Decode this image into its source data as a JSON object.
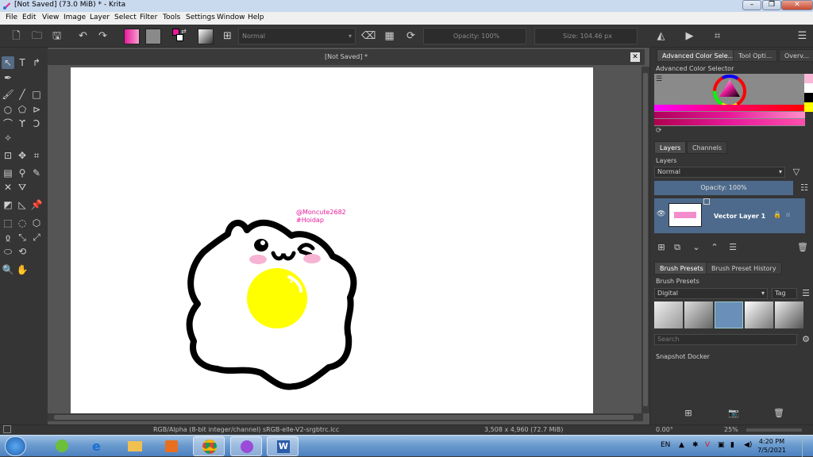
{
  "window": {
    "title": "[Not Saved]  (73.0 MiB)  * - Krita",
    "controls": {
      "minimize": "–",
      "maximize": "❐",
      "close": "✕"
    }
  },
  "menu": [
    "File",
    "Edit",
    "View",
    "Image",
    "Layer",
    "Select",
    "Filter",
    "Tools",
    "Settings",
    "Window",
    "Help"
  ],
  "toolbar": {
    "blend_mode": "Normal",
    "opacity": "Opacity: 100%",
    "size": "Size: 104.46 px",
    "colors": {
      "foreground": "#e8199a",
      "background": "#ffffff"
    }
  },
  "document": {
    "tab_title": "[Not Saved]  *",
    "close_label": "✕",
    "watermark_line1": "@Moncute2682",
    "watermark_line2": "#Hoidap"
  },
  "status": {
    "color_space": "RGB/Alpha (8-bit integer/channel)  sRGB-elle-V2-srgbtrc.icc",
    "dimensions": "3,508 x 4,960 (72.7 MiB)",
    "rotation": "0.00°",
    "zoom": "25%"
  },
  "dockers": {
    "top_tabs": [
      "Advanced Color Sele...",
      "Tool Opti...",
      "Overv..."
    ],
    "color_selector_title": "Advanced Color Selector",
    "layers_tabs": [
      "Layers",
      "Channels"
    ],
    "layers_title": "Layers",
    "layers_blend": "Normal",
    "layers_opacity": "Opacity:  100%",
    "layer_name": "Vector Layer 1",
    "brush_tabs": [
      "Brush Presets",
      "Brush Preset History"
    ],
    "brush_title": "Brush Presets",
    "brush_tag": "Digital",
    "tag_label": "Tag",
    "search_placeholder": "Search",
    "snapshot_title": "Snapshot Docker"
  },
  "taskbar": {
    "language": "EN",
    "time": "4:20 PM",
    "date": "7/5/2021"
  }
}
